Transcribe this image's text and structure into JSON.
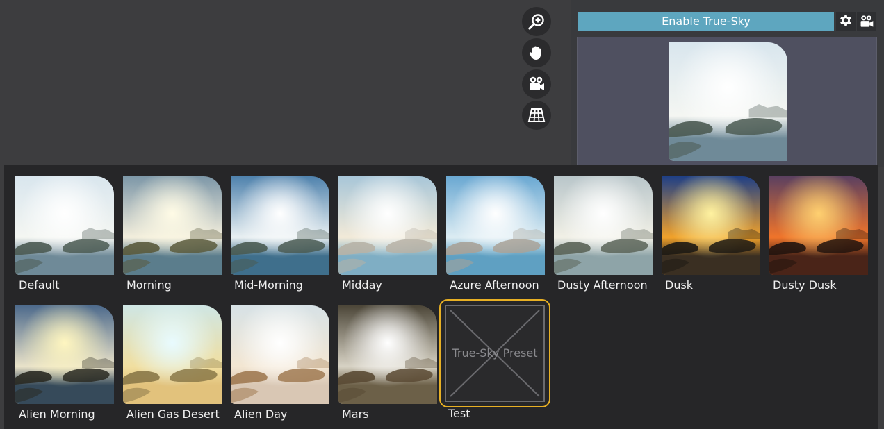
{
  "sidebar": {
    "enable_label": "Enable True-Sky",
    "settings_icon": "gear-icon",
    "camera_icon": "camera-icon"
  },
  "viewport_tools": [
    "zoom-in-icon",
    "pan-hand-icon",
    "camera-icon",
    "grid-icon"
  ],
  "presets": [
    {
      "name": "Default",
      "sky_top": "#d9e6ee",
      "sky_bottom": "#f4f6f2",
      "sun": "#ffffff",
      "water": "#6f8a98",
      "land": "#4b5a52",
      "style": "bright"
    },
    {
      "name": "Morning",
      "sky_top": "#7d97a8",
      "sky_bottom": "#f3eedc",
      "sun": "#fffbe6",
      "water": "#5b7d8c",
      "land": "#5a5a3c",
      "style": "warm"
    },
    {
      "name": "Mid-Morning",
      "sky_top": "#4f82ad",
      "sky_bottom": "#e9f0f2",
      "sun": "#ffffff",
      "water": "#3f6f8c",
      "land": "#4a5b52",
      "style": "blue"
    },
    {
      "name": "Midday",
      "sky_top": "#a8c6d8",
      "sky_bottom": "#f2ead8",
      "sun": "#ffffff",
      "water": "#7faec4",
      "land": "#b7b2a6",
      "style": "clear"
    },
    {
      "name": "Azure Afternoon",
      "sky_top": "#6aa8d2",
      "sky_bottom": "#dcecf3",
      "sun": "#ffffff",
      "water": "#5fa0c2",
      "land": "#a9a298",
      "style": "clear"
    },
    {
      "name": "Dusty Afternoon",
      "sky_top": "#b9c6ca",
      "sky_bottom": "#f1f0e6",
      "sun": "#ffffff",
      "water": "#8ea4a8",
      "land": "#5b6458",
      "style": "bright"
    },
    {
      "name": "Dusk",
      "sky_top": "#1f3f86",
      "sky_bottom": "#f2a22a",
      "sun": "#fff2a0",
      "water": "#3a2f22",
      "land": "#1d1a14",
      "style": "dusk"
    },
    {
      "name": "Dusty Dusk",
      "sky_top": "#5b4060",
      "sky_bottom": "#f0742a",
      "sun": "#ffd070",
      "water": "#4a2418",
      "land": "#22140e",
      "style": "dusk"
    },
    {
      "name": "Alien Morning",
      "sky_top": "#4d6a8c",
      "sky_bottom": "#e9e2c9",
      "sun": "#fff6c0",
      "water": "#364a5a",
      "land": "#2a2a22",
      "style": "warm"
    },
    {
      "name": "Alien Gas Desert",
      "sky_top": "#cfe6e4",
      "sky_bottom": "#f1dfa0",
      "sun": "#e8fbff",
      "water": "#e2c27c",
      "land": "#8a7848",
      "style": "desert"
    },
    {
      "name": "Alien Day",
      "sky_top": "#d7e2e6",
      "sky_bottom": "#f3e6d2",
      "sun": "#ffffff",
      "water": "#d9c7b4",
      "land": "#a07a52",
      "style": "desert"
    },
    {
      "name": "Mars",
      "sky_top": "#4c4638",
      "sky_bottom": "#d7d2c4",
      "sun": "#ffffff",
      "water": "#6c6048",
      "land": "#5a4a34",
      "style": "mars"
    }
  ],
  "custom_preset": {
    "name": "Test",
    "placeholder": "True-Sky Preset"
  }
}
